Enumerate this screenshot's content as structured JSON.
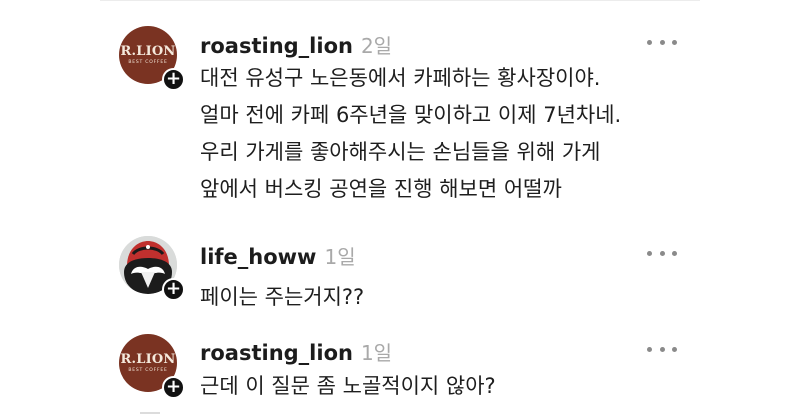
{
  "comments": [
    {
      "username": "roasting_lion",
      "time": "2일",
      "avatar": {
        "type": "brand-logo",
        "brand": "R.LION",
        "subtitle": "BEST COFFEE",
        "color": "#7a3322"
      },
      "lines": [
        "대전 유성구 노은동에서 카페하는 황사장이야.",
        "얼마 전에 카페 6주년을 맞이하고 이제 7년차네.",
        "우리 가게를 좋아해주시는 손님들을 위해 가게",
        "앞에서 버스킹 공연을 진행 해보면 어떨까"
      ]
    },
    {
      "username": "life_howw",
      "time": "1일",
      "avatar": {
        "type": "photo",
        "description": "helmet-character-icon"
      },
      "lines": [
        "페이는 주는거지??"
      ]
    },
    {
      "username": "roasting_lion",
      "time": "1일",
      "avatar": {
        "type": "brand-logo",
        "brand": "R.LION",
        "subtitle": "BEST COFFEE",
        "color": "#7a3322"
      },
      "lines": [
        "근데 이 질문 좀 노골적이지 않아?"
      ]
    }
  ],
  "icons": {
    "follow": "plus-icon",
    "menu": "more-options-icon"
  },
  "colors": {
    "time_text": "#a9a9a9",
    "brand_avatar": "#7a3322",
    "follow_badge": "#111111"
  }
}
